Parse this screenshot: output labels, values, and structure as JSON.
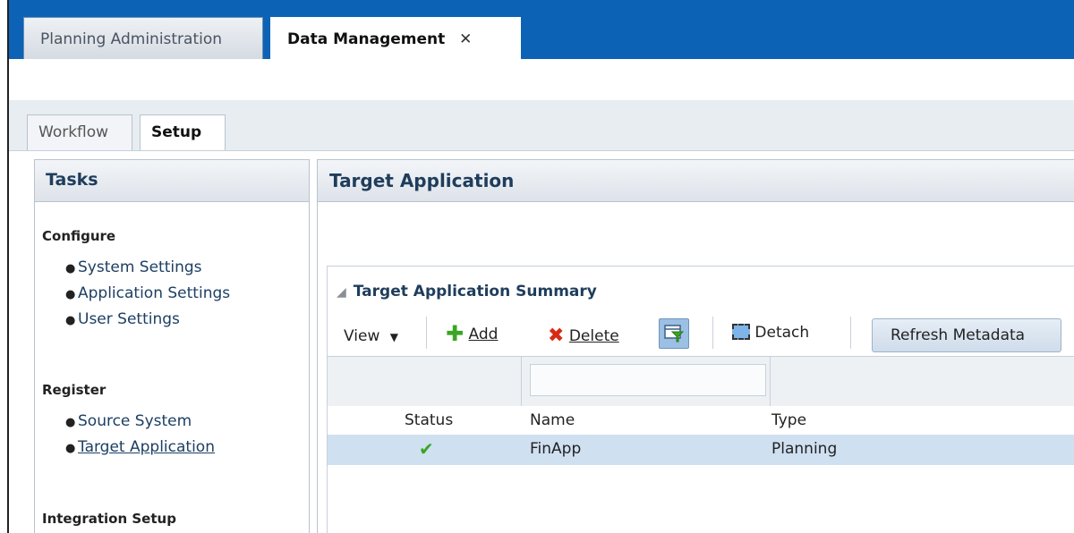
{
  "app_tabs": {
    "inactive_label": "Planning Administration",
    "active_label": "Data Management",
    "close_glyph": "✕"
  },
  "sub_tabs": {
    "workflow_label": "Workflow",
    "setup_label": "Setup"
  },
  "tasks": {
    "title": "Tasks",
    "configure": {
      "title": "Configure",
      "items": [
        "System Settings",
        "Application Settings",
        "User Settings"
      ]
    },
    "register": {
      "title": "Register",
      "items": [
        "Source System",
        "Target Application"
      ]
    },
    "integration": {
      "title": "Integration Setup"
    }
  },
  "target": {
    "title": "Target Application",
    "summary_title": "Target Application Summary",
    "toolbar": {
      "view_label": "View",
      "add_label": "Add",
      "delete_label": "Delete",
      "detach_label": "Detach",
      "refresh_label": "Refresh Metadata"
    },
    "columns": [
      "Status",
      "Name",
      "Type"
    ],
    "rows": [
      {
        "status": "✔",
        "name": "FinApp",
        "type": "Planning"
      }
    ]
  },
  "colors": {
    "top_bar": "#0c63b6",
    "selected_row": "#cfe0f1",
    "link": "#1d3f63",
    "add_icon": "#3aa522",
    "delete_icon": "#d82b16"
  },
  "icons": [
    "close-icon",
    "collapse-triangle-icon",
    "chevron-down-icon",
    "add-icon",
    "delete-icon",
    "filter-icon",
    "detach-icon",
    "check-icon"
  ]
}
